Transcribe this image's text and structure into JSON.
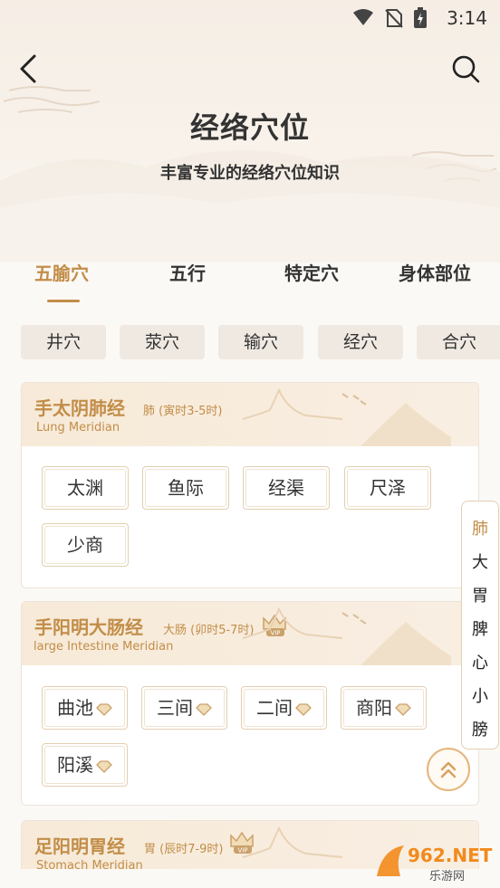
{
  "status": {
    "time": "3:14"
  },
  "header": {
    "title": "经络穴位",
    "subtitle": "丰富专业的经络穴位知识"
  },
  "tabs": [
    {
      "label": "五腧穴",
      "active": true
    },
    {
      "label": "五行",
      "active": false
    },
    {
      "label": "特定穴",
      "active": false
    },
    {
      "label": "身体部位",
      "active": false
    }
  ],
  "chips": [
    "井穴",
    "荥穴",
    "输穴",
    "经穴",
    "合穴"
  ],
  "cards": [
    {
      "title": "手太阴肺经",
      "sub": "肺 (寅时3-5时)",
      "en": "Lung Meridian",
      "vip": false,
      "points": [
        "太渊",
        "鱼际",
        "经渠",
        "尺泽",
        "少商"
      ]
    },
    {
      "title": "手阳明大肠经",
      "sub": "大肠 (卯时5-7时)",
      "en": "large Intestine Meridian",
      "vip": true,
      "points": [
        "曲池",
        "三间",
        "二间",
        "商阳",
        "阳溪"
      ]
    },
    {
      "title": "足阳明胃经",
      "sub": "胃 (辰时7-9时)",
      "en": "Stomach Meridian",
      "vip": true,
      "points": []
    }
  ],
  "side_index": [
    "肺",
    "大",
    "胃",
    "脾",
    "心",
    "小",
    "膀"
  ],
  "watermark": {
    "text": "962.NET",
    "sub": "乐游网"
  },
  "colors": {
    "accent": "#c28d48",
    "card_head": "#f7ead8",
    "chip_bg": "#efe9e2"
  }
}
